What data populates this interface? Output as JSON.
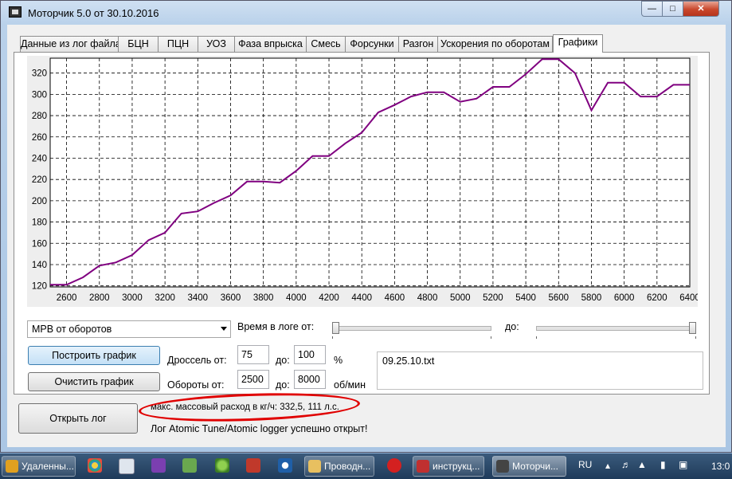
{
  "window": {
    "title": "Моторчик 5.0 от 30.10.2016"
  },
  "tabs": [
    {
      "label": "Данные из лог файла"
    },
    {
      "label": "БЦН"
    },
    {
      "label": "ПЦН"
    },
    {
      "label": "УОЗ"
    },
    {
      "label": "Фаза впрыска"
    },
    {
      "label": "Смесь"
    },
    {
      "label": "Форсунки"
    },
    {
      "label": "Разгон"
    },
    {
      "label": "Ускорения по оборотам"
    },
    {
      "label": "Графики"
    }
  ],
  "active_tab": "Графики",
  "chart_data": {
    "type": "line",
    "title": "",
    "xlabel": "",
    "ylabel": "",
    "xlim": [
      2500,
      6400
    ],
    "ylim": [
      119,
      334
    ],
    "grid": true,
    "line_color": "#800080",
    "x_ticks": [
      2600,
      2800,
      3000,
      3200,
      3400,
      3600,
      3800,
      4000,
      4200,
      4400,
      4600,
      4800,
      5000,
      5200,
      5400,
      5600,
      5800,
      6000,
      6200,
      6400
    ],
    "y_ticks": [
      120,
      140,
      160,
      180,
      200,
      220,
      240,
      260,
      280,
      300,
      320
    ],
    "x": [
      2500,
      2600,
      2700,
      2800,
      2900,
      3000,
      3100,
      3200,
      3300,
      3400,
      3500,
      3600,
      3700,
      3800,
      3900,
      4000,
      4100,
      4200,
      4300,
      4400,
      4500,
      4600,
      4700,
      4800,
      4900,
      5000,
      5100,
      5200,
      5300,
      5400,
      5500,
      5600,
      5700,
      5800,
      5900,
      6000,
      6100,
      6200,
      6300,
      6400
    ],
    "y": [
      121,
      121,
      128,
      139,
      142,
      149,
      163,
      170,
      188,
      190,
      198,
      205,
      218,
      218,
      217,
      228,
      242,
      242,
      254,
      264,
      283,
      290,
      298,
      302,
      302,
      293,
      296,
      307,
      307,
      319,
      333,
      333,
      320,
      285,
      311,
      311,
      298,
      298,
      309,
      309
    ]
  },
  "controls": {
    "mode_select": "МРВ от оборотов",
    "time_label": "Время в логе от:",
    "time_to_label": "до:",
    "time_from_value": 0,
    "time_to_value": 1,
    "build_button": "Построить график",
    "clear_button": "Очистить график",
    "throttle_label": "Дроссель от:",
    "throttle_from": "75",
    "throttle_to_label": "до:",
    "throttle_to": "100",
    "throttle_unit": "%",
    "rpm_label": "Обороты от:",
    "rpm_from": "2500",
    "rpm_to_label": "до:",
    "rpm_to": "8000",
    "rpm_unit": "об/мин",
    "file_name": "09.25.10.txt",
    "open_log_button": "Открыть лог"
  },
  "status": {
    "max_flow": "макс. массовый расход в кг/ч: 332,5, 111 л.с.",
    "log_message": "Лог Atomic Tune/Atomic logger успешно открыт!"
  },
  "taskbar": {
    "items": [
      {
        "label": "Удаленны...",
        "icon": "remote-desktop-icon",
        "color": "#e0a020"
      },
      {
        "label": "Проводн...",
        "icon": "folder-icon",
        "color": "#e8c060"
      },
      {
        "label": "инструкц...",
        "icon": "document-icon",
        "color": "#c03030"
      },
      {
        "label": "Моторчи...",
        "icon": "app-icon",
        "color": "#444444"
      }
    ],
    "language": "RU",
    "clock": "13:0"
  }
}
